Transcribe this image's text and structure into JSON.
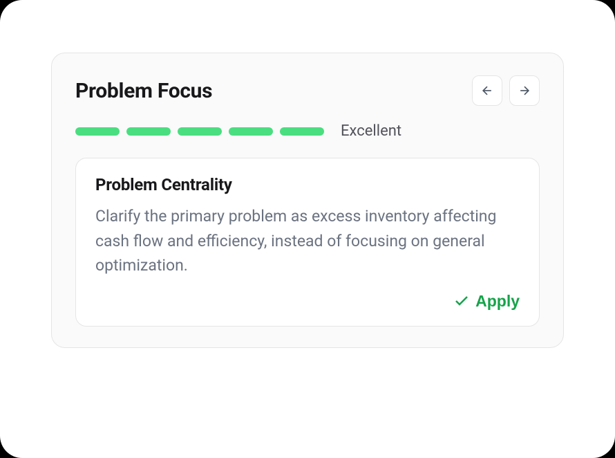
{
  "card": {
    "title": "Problem Focus",
    "rating": {
      "segments": 5,
      "active_segments": 5,
      "label": "Excellent",
      "color": "#4ade80"
    }
  },
  "suggestion": {
    "title": "Problem Centrality",
    "description": "Clarify the primary problem as excess inventory affecting cash flow and efficiency, instead of focusing on general optimization.",
    "apply_label": "Apply"
  }
}
